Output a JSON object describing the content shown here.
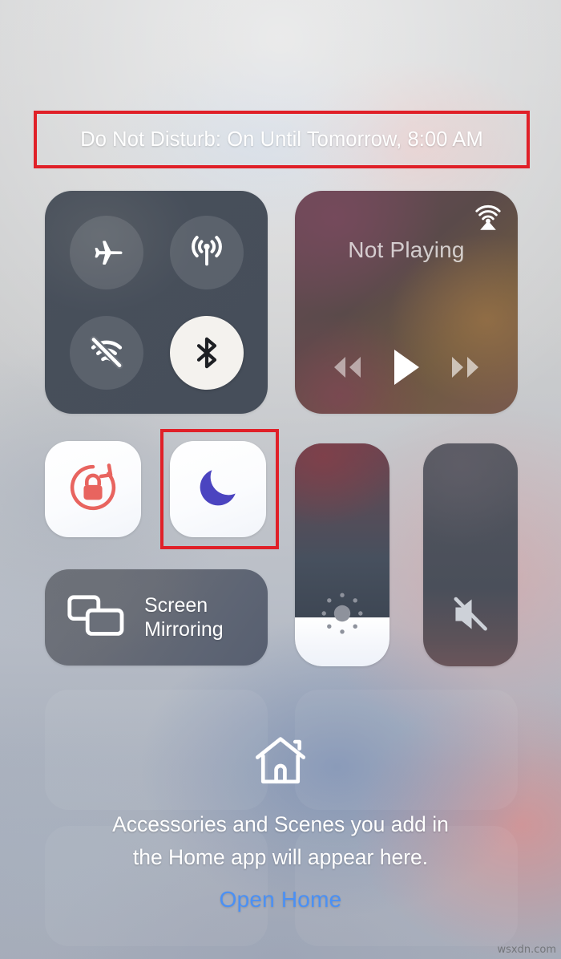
{
  "banner": {
    "text": "Do Not Disturb: On Until Tomorrow, 8:00 AM",
    "highlight_color": "#e02028"
  },
  "connectivity": {
    "toggles": [
      {
        "name": "airplane-mode",
        "label": "Airplane Mode",
        "icon": "airplane-icon",
        "state": "off"
      },
      {
        "name": "cellular-data",
        "label": "Cellular Data",
        "icon": "cellular-icon",
        "state": "off"
      },
      {
        "name": "wifi",
        "label": "Wi-Fi",
        "icon": "wifi-off-icon",
        "state": "off"
      },
      {
        "name": "bluetooth",
        "label": "Bluetooth",
        "icon": "bluetooth-icon",
        "state": "on"
      }
    ]
  },
  "music": {
    "now_playing": "Not Playing",
    "airplay_icon": "airplay-icon",
    "controls": [
      {
        "name": "rewind-button",
        "label": "Rewind",
        "icon": "rewind-icon"
      },
      {
        "name": "play-button",
        "label": "Play",
        "icon": "play-icon"
      },
      {
        "name": "fast-forward-button",
        "label": "Fast Forward",
        "icon": "fast-forward-icon"
      }
    ]
  },
  "tiles": {
    "rotation_lock": {
      "label": "Portrait Orientation Lock",
      "icon": "rotation-lock-icon",
      "state": "on",
      "color": "#e8645f"
    },
    "do_not_disturb": {
      "label": "Do Not Disturb",
      "icon": "moon-icon",
      "state": "on",
      "color": "#4b44c0",
      "highlighted": true
    }
  },
  "sliders": {
    "brightness": {
      "label": "Brightness",
      "icon": "brightness-icon",
      "value_percent": 22
    },
    "volume": {
      "label": "Volume",
      "icon": "volume-mute-icon",
      "value_percent": 0
    }
  },
  "screen_mirroring": {
    "line1": "Screen",
    "line2": "Mirroring",
    "icon": "screen-mirroring-icon"
  },
  "home": {
    "icon": "home-icon",
    "description_line1": "Accessories and Scenes you add in",
    "description_line2": "the Home app will appear here.",
    "open_link": "Open Home",
    "link_color": "#4a90f5"
  },
  "watermark": "wsxdn.com"
}
